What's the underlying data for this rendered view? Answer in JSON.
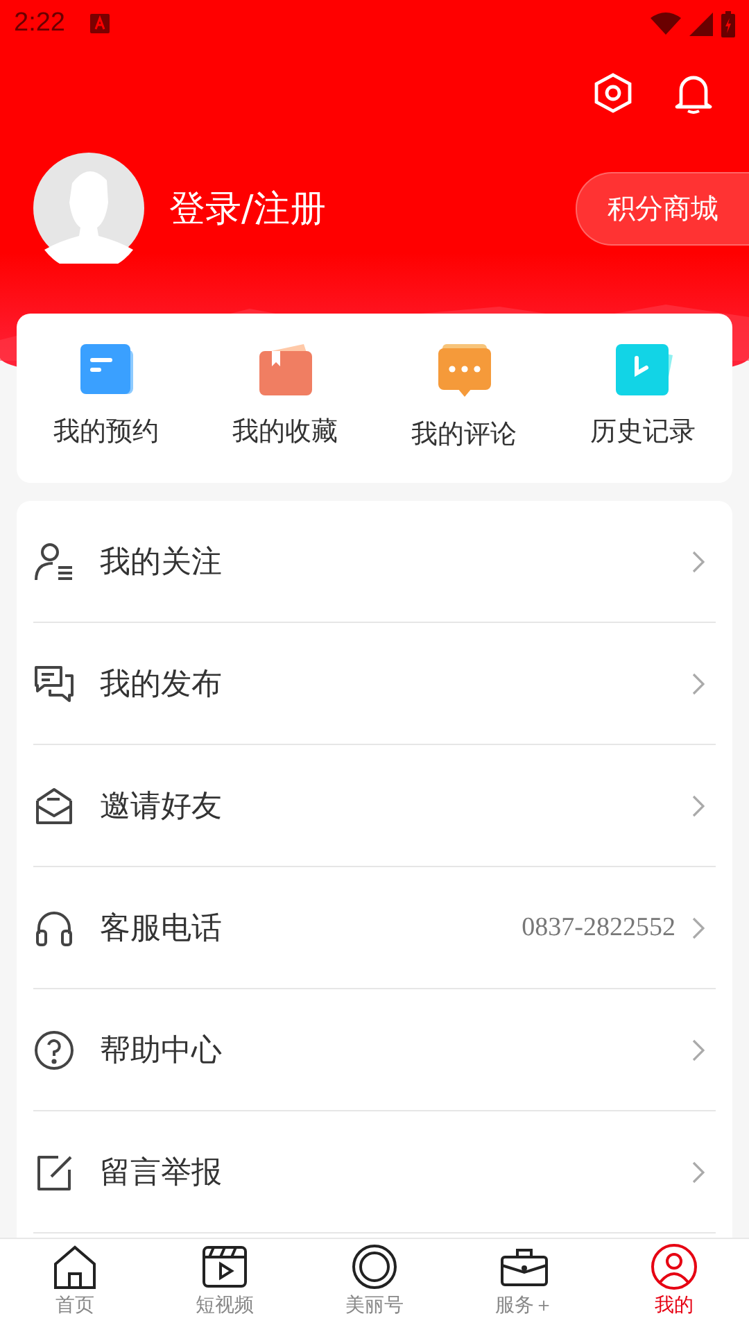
{
  "status_bar": {
    "time": "2:22"
  },
  "profile": {
    "login_label": "登录/注册",
    "points_button": "积分商城"
  },
  "shortcuts": [
    {
      "label": "我的预约"
    },
    {
      "label": "我的收藏"
    },
    {
      "label": "我的评论"
    },
    {
      "label": "历史记录"
    }
  ],
  "menu": [
    {
      "label": "我的关注"
    },
    {
      "label": "我的发布"
    },
    {
      "label": "邀请好友"
    },
    {
      "label": "客服电话",
      "value": "0837-2822552"
    },
    {
      "label": "帮助中心"
    },
    {
      "label": "留言举报"
    }
  ],
  "tab_bar": [
    {
      "label": "首页",
      "selected": false
    },
    {
      "label": "短视频",
      "selected": false
    },
    {
      "label": "美丽号",
      "selected": false
    },
    {
      "label": "服务＋",
      "selected": false
    },
    {
      "label": "我的",
      "selected": true
    }
  ]
}
